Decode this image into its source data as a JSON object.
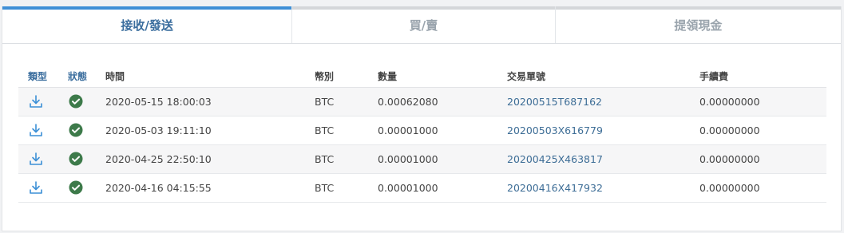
{
  "tabs": [
    {
      "label": "接收/發送"
    },
    {
      "label": "買/賣"
    },
    {
      "label": "提領現金"
    }
  ],
  "table": {
    "headers": {
      "type": "類型",
      "status": "狀態",
      "time": "時間",
      "currency": "幣別",
      "amount": "數量",
      "tx": "交易單號",
      "fee": "手續費"
    },
    "rows": [
      {
        "type_icon": "download-icon",
        "status_icon": "check-circle-icon",
        "time": "2020-05-15 18:00:03",
        "currency": "BTC",
        "amount": "0.00062080",
        "tx": "20200515T687162",
        "fee": "0.00000000"
      },
      {
        "type_icon": "download-icon",
        "status_icon": "check-circle-icon",
        "time": "2020-05-03 19:11:10",
        "currency": "BTC",
        "amount": "0.00001000",
        "tx": "20200503X616779",
        "fee": "0.00000000"
      },
      {
        "type_icon": "download-icon",
        "status_icon": "check-circle-icon",
        "time": "2020-04-25 22:50:10",
        "currency": "BTC",
        "amount": "0.00001000",
        "tx": "20200425X463817",
        "fee": "0.00000000"
      },
      {
        "type_icon": "download-icon",
        "status_icon": "check-circle-icon",
        "time": "2020-04-16 04:15:55",
        "currency": "BTC",
        "amount": "0.00001000",
        "tx": "20200416X417932",
        "fee": "0.00000000"
      }
    ]
  },
  "colors": {
    "accent": "#3f8fd6",
    "link": "#3d6d96",
    "success": "#3d7a4a"
  }
}
